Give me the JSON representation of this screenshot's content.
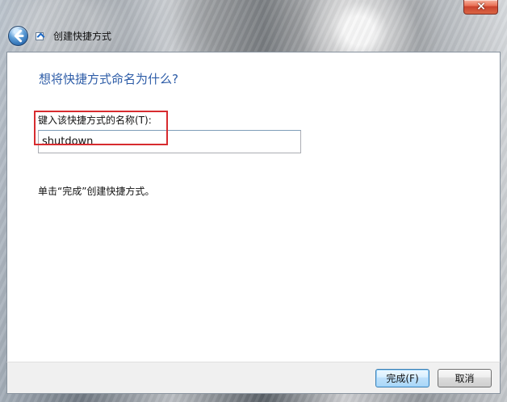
{
  "window": {
    "title": "创建快捷方式",
    "close_icon": "close-icon",
    "back_icon": "back-arrow-icon",
    "shortcut_icon": "shortcut-icon"
  },
  "page": {
    "heading": "想将快捷方式命名为什么?",
    "field_label": "键入该快捷方式的名称(T):",
    "shortcut_name": "shutdown",
    "instruction": "单击“完成”创建快捷方式。"
  },
  "buttons": {
    "finish": "完成(F)",
    "cancel": "取消"
  },
  "colors": {
    "heading": "#2d5ca7",
    "highlight_box": "#d72b2f",
    "close_button": "#d95a3e"
  }
}
